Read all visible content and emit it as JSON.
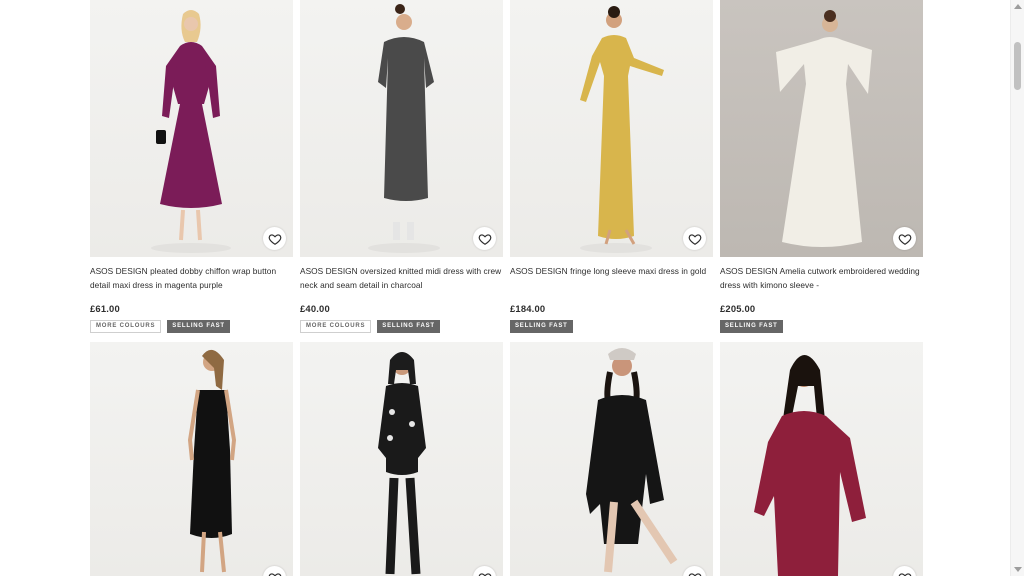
{
  "products": [
    {
      "title": "ASOS DESIGN pleated dobby chiffon wrap button detail maxi dress in magenta purple",
      "price": "£61.00",
      "badges": [
        "MORE COLOURS",
        "SELLING FAST"
      ],
      "dress_color": "#7b1c58"
    },
    {
      "title": "ASOS DESIGN oversized knitted midi dress with crew neck and seam detail in charcoal",
      "price": "£40.00",
      "badges": [
        "MORE COLOURS",
        "SELLING FAST"
      ],
      "dress_color": "#4a4a4a"
    },
    {
      "title": "ASOS DESIGN fringe long sleeve maxi dress in gold",
      "price": "£184.00",
      "badges": [
        "SELLING FAST"
      ],
      "dress_color": "#d8b54c"
    },
    {
      "title": "ASOS DESIGN Amelia cutwork embroidered wedding dress with kimono sleeve -",
      "price": "£205.00",
      "badges": [
        "SELLING FAST"
      ],
      "dress_color": "#f1eee6"
    },
    {
      "dress_color": "#111111"
    },
    {
      "dress_color": "#1a1a1a"
    },
    {
      "dress_color": "#151515"
    },
    {
      "dress_color": "#8e1f3b"
    }
  ],
  "colors": {
    "badge_dark": "#666666",
    "text": "#2d2d2d"
  },
  "icons": {
    "save": "heart-icon"
  }
}
